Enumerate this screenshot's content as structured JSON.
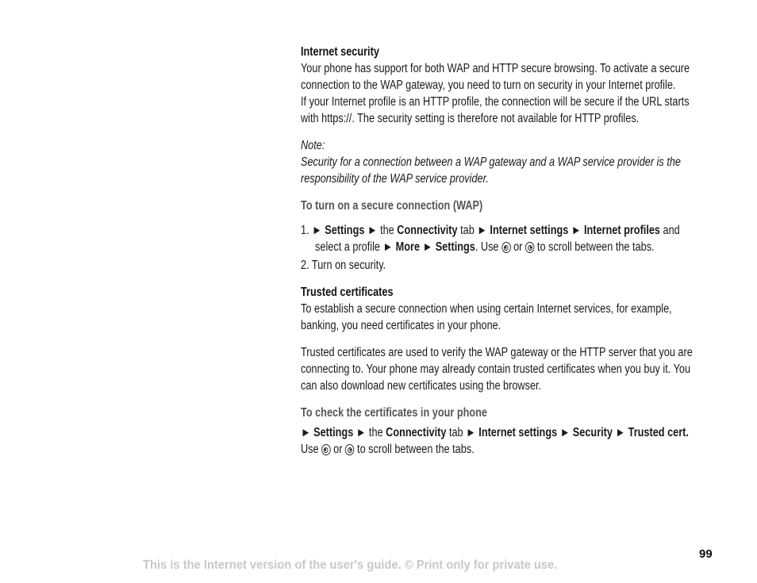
{
  "section1": {
    "heading": "Internet security",
    "lines": [
      "Your phone has support for both WAP and HTTP secure browsing. To activate a secure",
      "connection to the WAP gateway, you need to turn on security in your Internet profile.",
      "If your Internet profile is an HTTP profile, the connection will be secure if the URL starts",
      "with https://. The security setting is therefore not available for HTTP profiles."
    ],
    "note_label": "Note:",
    "note_lines": [
      "Security for a connection between a WAP gateway and a WAP service provider is the",
      "responsibility of the WAP service provider."
    ]
  },
  "procedure1": {
    "heading": "To turn on a secure connection (WAP)",
    "step1": {
      "num": "1.",
      "settings": "Settings",
      "the": "the",
      "connectivity": "Connectivity",
      "tab": "tab",
      "internet_settings": "Internet settings",
      "internet_profiles": "Internet profiles",
      "and": "and",
      "select": "select a profile",
      "more": "More",
      "settings2": "Settings",
      "use": ". Use",
      "or": "or",
      "scroll": "to scroll between the tabs."
    },
    "step2": {
      "num": "2.",
      "text": "Turn on security."
    }
  },
  "section2": {
    "heading": "Trusted certificates",
    "para1": [
      "To establish a secure connection when using certain Internet services, for example,",
      "banking, you need certificates in your phone."
    ],
    "para2": [
      "Trusted certificates are used to verify the WAP gateway or the HTTP server that you are",
      "connecting to. Your phone may already contain trusted certificates when you buy it. You",
      "can also download new certificates using the browser."
    ]
  },
  "procedure2": {
    "heading": "To check the certificates in your phone",
    "settings": "Settings",
    "the": "the",
    "connectivity": "Connectivity",
    "tab": "tab",
    "internet_settings": "Internet settings",
    "security": "Security",
    "trusted": "Trusted cert.",
    "use": "Use",
    "or": "or",
    "scroll": "to scroll between the tabs."
  },
  "footer": {
    "page_number": "99",
    "disclaimer": "This is the Internet version of the user's guide. © Print only for private use."
  },
  "icons": {
    "arrow": "►"
  }
}
